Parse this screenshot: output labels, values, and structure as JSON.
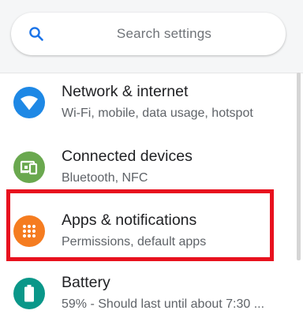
{
  "search": {
    "placeholder": "Search settings",
    "icon": "search-icon",
    "icon_color": "#1a73e8"
  },
  "settings_items": [
    {
      "title": "Network & internet",
      "subtitle": "Wi-Fi, mobile, data usage, hotspot",
      "icon": "wifi-icon",
      "icon_color": "#1e88e5"
    },
    {
      "title": "Connected devices",
      "subtitle": "Bluetooth, NFC",
      "icon": "connected-devices-icon",
      "icon_color": "#6aa84f"
    },
    {
      "title": "Apps & notifications",
      "subtitle": "Permissions, default apps",
      "icon": "apps-grid-icon",
      "icon_color": "#f57c20"
    },
    {
      "title": "Battery",
      "subtitle": "59% - Should last until about 7:30 ...",
      "icon": "battery-icon",
      "icon_color": "#0a9789"
    }
  ],
  "highlight": {
    "color": "#e8111e",
    "target": "Apps & notifications"
  }
}
